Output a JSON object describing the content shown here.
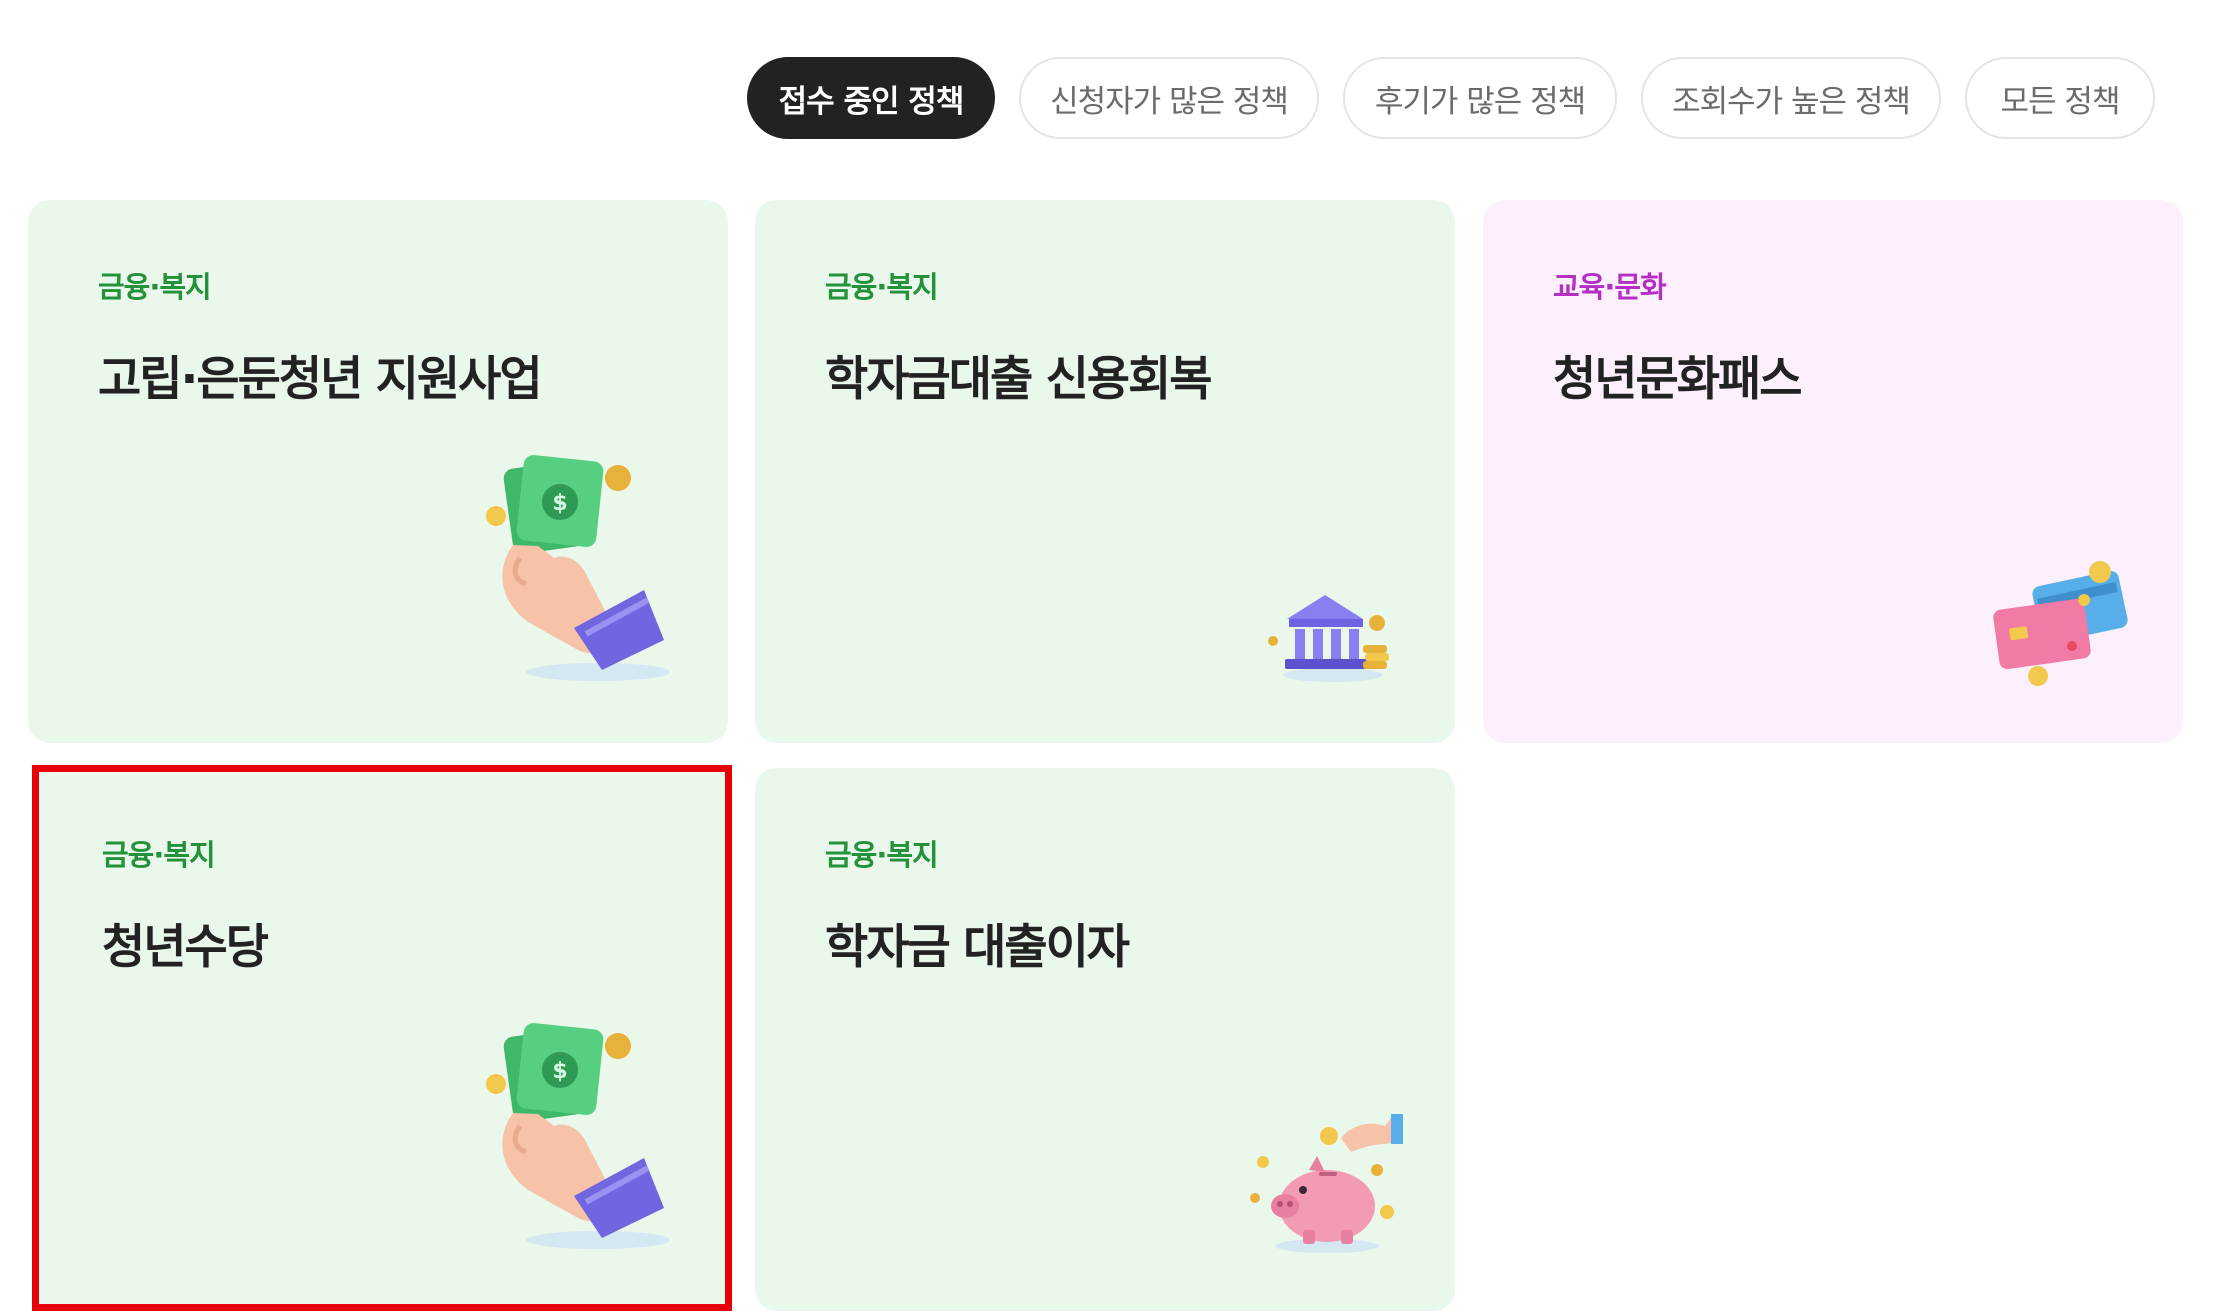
{
  "filters": [
    {
      "label": "접수 중인 정책",
      "active": true
    },
    {
      "label": "신청자가 많은 정책",
      "active": false
    },
    {
      "label": "후기가 많은 정책",
      "active": false
    },
    {
      "label": "조회수가 높은 정책",
      "active": false
    },
    {
      "label": "모든 정책",
      "active": false
    }
  ],
  "cards": [
    {
      "category": "금융·복지",
      "title": "고립·은둔청년 지원사업",
      "icon": "money-hand-icon"
    },
    {
      "category": "금융·복지",
      "title": "학자금대출 신용회복",
      "icon": "bank-icon"
    },
    {
      "category": "교육·문화",
      "title": "청년문화패스",
      "icon": "credit-card-icon"
    },
    {
      "category": "금융·복지",
      "title": "청년수당",
      "icon": "money-hand-icon"
    },
    {
      "category": "금융·복지",
      "title": "학자금 대출이자",
      "icon": "piggy-bank-icon"
    }
  ],
  "colors": {
    "active_tab": "#222222",
    "green_card_bg": "#eaf8ec",
    "pink_card_bg": "#fbf0fc",
    "green_category": "#23923a",
    "pink_category": "#b42fc3",
    "highlight_border": "#e8000b"
  }
}
